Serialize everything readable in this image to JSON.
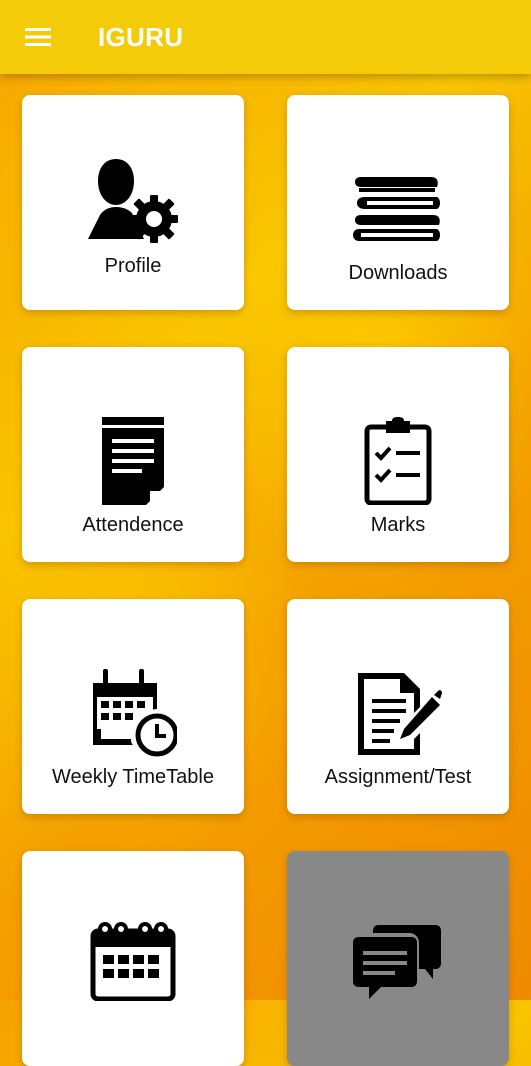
{
  "app": {
    "title": "IGURU"
  },
  "icons": {
    "menu": "hamburger-menu-icon"
  },
  "colors": {
    "appbar": "#f3cb09",
    "background_primary": "#f9c400",
    "background_secondary": "#f08a00",
    "tile": "#ffffff",
    "tile_disabled": "#888888",
    "icon": "#000000",
    "label": "#111111"
  },
  "tiles": [
    {
      "label": "Profile",
      "icon": "user-settings-icon"
    },
    {
      "label": "Downloads",
      "icon": "books-icon"
    },
    {
      "label": "Attendence",
      "icon": "notepad-icon"
    },
    {
      "label": "Marks",
      "icon": "clipboard-checklist-icon"
    },
    {
      "label": "Weekly TimeTable",
      "icon": "calendar-clock-icon"
    },
    {
      "label": "Assignment/Test",
      "icon": "document-pen-icon"
    },
    {
      "label": "",
      "icon": "calendar-icon"
    },
    {
      "label": "",
      "icon": "chat-bubbles-icon"
    }
  ]
}
